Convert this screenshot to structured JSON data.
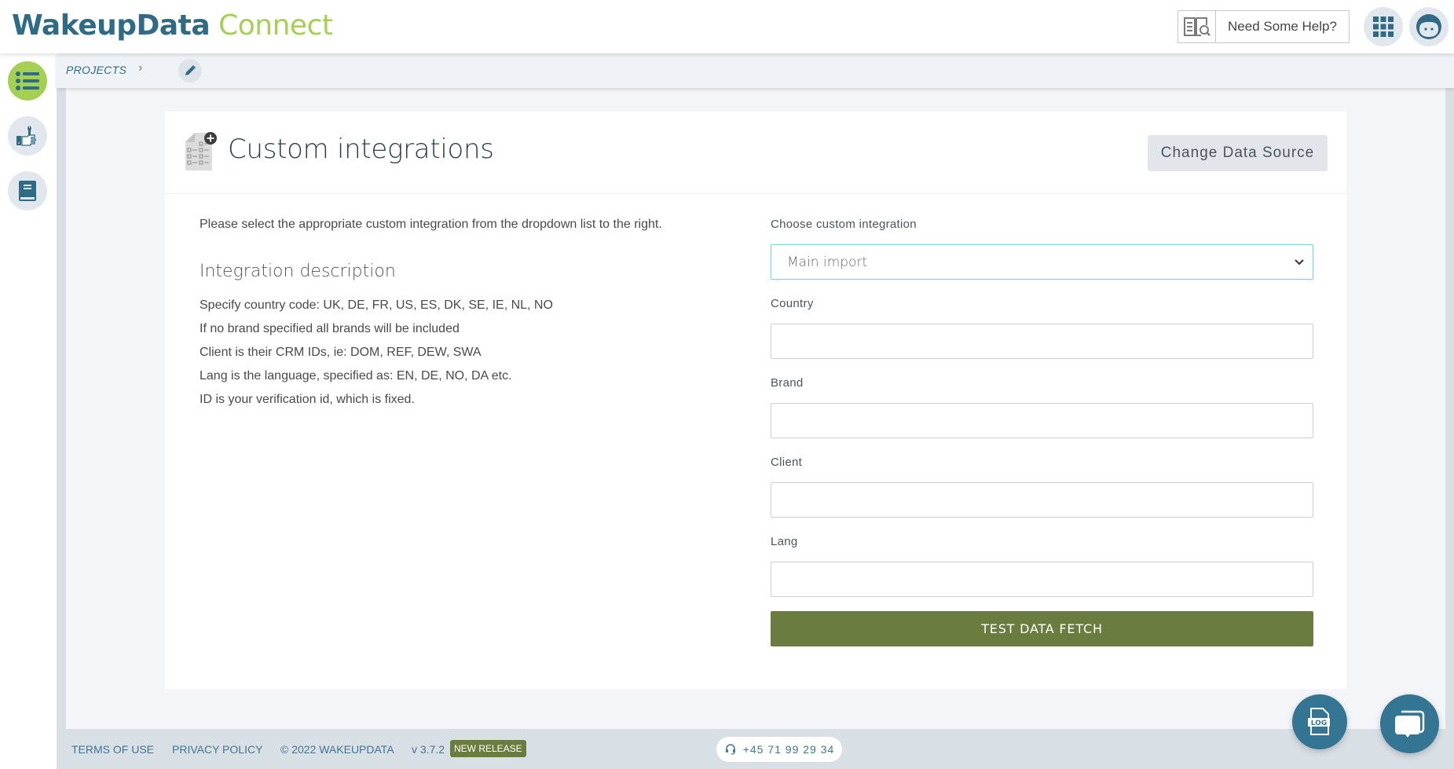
{
  "header": {
    "logo_primary": "WakeupData",
    "logo_secondary": "Connect",
    "help_label": "Need Some Help?",
    "icons": [
      "help-book-icon",
      "apps-grid-icon",
      "user-avatar-icon"
    ]
  },
  "sidebar": {
    "items": [
      {
        "name": "projects",
        "icon": "list-icon",
        "active": true
      },
      {
        "name": "tools",
        "icon": "wrench-hand-icon",
        "active": false
      },
      {
        "name": "docs",
        "icon": "book-icon",
        "active": false
      }
    ]
  },
  "breadcrumb": {
    "items": [
      "PROJECTS"
    ],
    "separator": "›",
    "edit_icon": "pencil-icon"
  },
  "card": {
    "title": "Custom integrations",
    "change_source_label": "Change Data Source",
    "intro": "Please select the appropriate custom integration from the dropdown list to the right.",
    "description_title": "Integration description",
    "description_lines": [
      "Specify country code: UK, DE, FR, US, ES, DK, SE, IE, NL, NO",
      "If no brand specified all brands will be included",
      "Client is their CRM IDs, ie: DOM, REF, DEW, SWA",
      "Lang is the language, specified as: EN, DE, NO, DA etc.",
      "ID is your verification id, which is fixed."
    ]
  },
  "form": {
    "integration_label": "Choose custom integration",
    "integration_selected": "Main import",
    "fields": [
      {
        "label": "Country",
        "value": ""
      },
      {
        "label": "Brand",
        "value": ""
      },
      {
        "label": "Client",
        "value": ""
      },
      {
        "label": "Lang",
        "value": ""
      }
    ],
    "submit_label": "TEST DATA FETCH"
  },
  "footer": {
    "terms": "TERMS OF USE",
    "privacy": "PRIVACY POLICY",
    "copyright": "© 2022 WAKEUPDATA",
    "version": "v 3.7.2",
    "release_badge": "NEW RELEASE",
    "phone": "+45 71 99 29 34"
  },
  "floating": {
    "log_label": "LOG",
    "chat_icon": "chat-icon"
  },
  "colors": {
    "brand_dark": "#2f6b85",
    "brand_green": "#a5d054",
    "button_green": "#6b7d3e",
    "fab_blue": "#357594",
    "select_focus": "#7fd8d0"
  }
}
